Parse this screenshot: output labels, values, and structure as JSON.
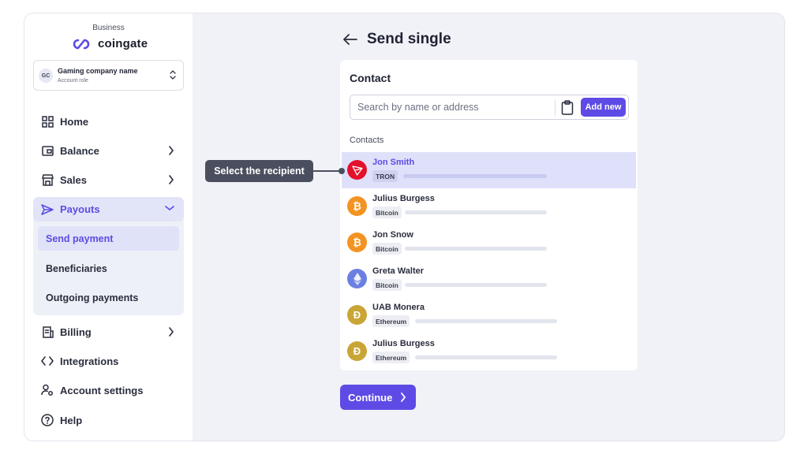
{
  "sidebar": {
    "brand_small": "Business",
    "logo_text": "coingate",
    "account": {
      "initials": "GC",
      "name": "Gaming company name",
      "role": "Account role"
    },
    "items": {
      "home": "Home",
      "balance": "Balance",
      "sales": "Sales",
      "payouts": "Payouts",
      "billing": "Billing",
      "integrations": "Integrations",
      "account_settings": "Account settings",
      "help": "Help"
    },
    "payouts_sub": [
      "Send payment",
      "Beneficiaries",
      "Outgoing payments"
    ]
  },
  "main": {
    "title": "Send single",
    "card_title": "Contact",
    "search_placeholder": "Search by name or address",
    "add_new": "Add new",
    "contacts_label": "Contacts",
    "contacts": [
      {
        "name": "Jon Smith",
        "tag": "TRON",
        "icon": "tron-icon",
        "color": "#e5112b"
      },
      {
        "name": "Julius Burgess",
        "tag": "Bitcoin",
        "icon": "bitcoin-icon",
        "color": "#f39321"
      },
      {
        "name": "Jon Snow",
        "tag": "Bitcoin",
        "icon": "bitcoin-icon",
        "color": "#f39321"
      },
      {
        "name": "Greta Walter",
        "tag": "Bitcoin",
        "icon": "ethereum-icon",
        "color": "#6b7fe3"
      },
      {
        "name": "UAB Monera",
        "tag": "Ethereum",
        "icon": "dogecoin-icon",
        "color": "#c9a536"
      },
      {
        "name": "Julius Burgess",
        "tag": "Ethereum",
        "icon": "dogecoin-icon",
        "color": "#c9a536"
      }
    ],
    "continue": "Continue"
  },
  "tooltip": "Select the recipient",
  "colors": {
    "accent": "#5e4be5",
    "selected_row": "#dfe1fb",
    "canvas": "#f1f2f7"
  }
}
